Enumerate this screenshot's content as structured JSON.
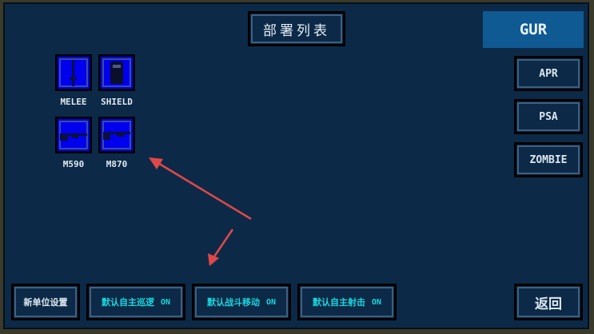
{
  "title": "部署列表",
  "factions": {
    "active": "GUR",
    "items": [
      "APR",
      "PSA",
      "ZOMBIE"
    ]
  },
  "weapons": [
    {
      "label": "MELEE",
      "icon": "knife-icon"
    },
    {
      "label": "SHIELD",
      "icon": "shield-icon"
    },
    {
      "label": "M590",
      "icon": "shotgun-icon"
    },
    {
      "label": "M870",
      "icon": "shotgun-icon"
    }
  ],
  "bottom": {
    "new_unit": "新单位设置",
    "patrol": {
      "label": "默认自主巡逻",
      "state": "ON"
    },
    "combat_move": {
      "label": "默认战斗移动",
      "state": "ON"
    },
    "auto_fire": {
      "label": "默认自主射击",
      "state": "ON"
    },
    "back": "返回"
  },
  "colors": {
    "panel": "#0c2a47",
    "accent_active": "#0f5a93",
    "toggle_text": "#19d7e0",
    "weapon_tile": "#0000ee",
    "arrow": "#e04848"
  }
}
